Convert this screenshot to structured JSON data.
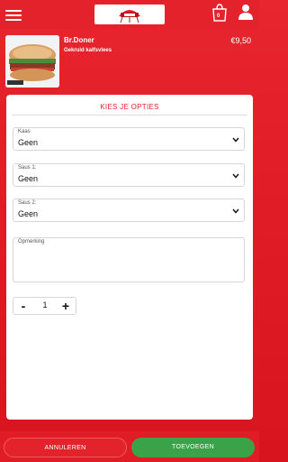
{
  "header": {
    "menu_icon": "hamburger-icon",
    "logo_icon": "restaurant-logo",
    "cart_icon": "shopping-bag-icon",
    "cart_count": "0",
    "user_icon": "user-icon"
  },
  "product": {
    "name": "Br.Doner",
    "description": "Gekruid kalfsvlees",
    "price": "€9,50"
  },
  "options": {
    "title": "KIES JE OPTIES",
    "fields": [
      {
        "label": "Kaas",
        "value": "Geen"
      },
      {
        "label": "Saus 1:",
        "value": "Geen"
      },
      {
        "label": "Saus 2:",
        "value": "Geen"
      }
    ],
    "remark_label": "Opmerking",
    "quantity": "1",
    "minus": "-",
    "plus": "+"
  },
  "footer": {
    "cancel_label": "ANNULEREN",
    "add_label": "TOEVOEGEN"
  },
  "colors": {
    "brand_red": "#e3222b",
    "accent_green": "#3aa34a"
  }
}
